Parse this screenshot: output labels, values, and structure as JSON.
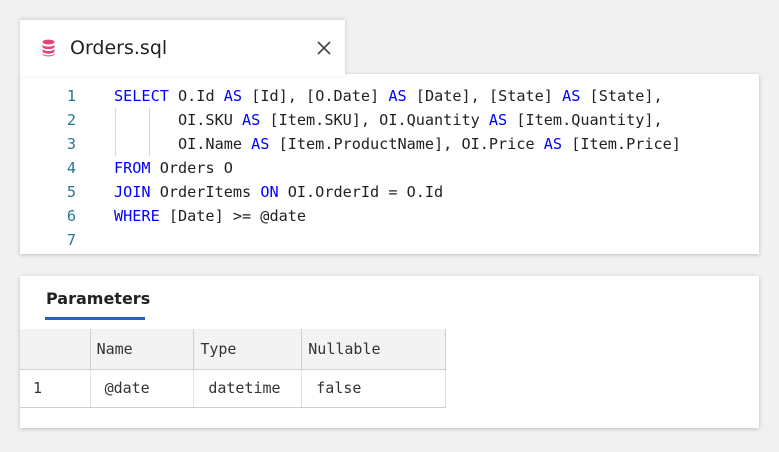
{
  "tab": {
    "title": "Orders.sql",
    "icon": "database-icon",
    "icon_color": "#e0457b",
    "close_icon": "close-icon"
  },
  "editor": {
    "keyword_color": "#0000ff",
    "line_number_color": "#237893",
    "lines": [
      {
        "num": "1",
        "tokens": [
          {
            "t": "SELECT",
            "kw": true
          },
          {
            "t": " O.Id ",
            "kw": false
          },
          {
            "t": "AS",
            "kw": true
          },
          {
            "t": " [Id], [O.Date] ",
            "kw": false
          },
          {
            "t": "AS",
            "kw": true
          },
          {
            "t": " [Date], [State] ",
            "kw": false
          },
          {
            "t": "AS",
            "kw": true
          },
          {
            "t": " [State],",
            "kw": false
          }
        ]
      },
      {
        "num": "2",
        "tokens": [
          {
            "t": "       OI.SKU ",
            "kw": false
          },
          {
            "t": "AS",
            "kw": true
          },
          {
            "t": " [Item.SKU], OI.Quantity ",
            "kw": false
          },
          {
            "t": "AS",
            "kw": true
          },
          {
            "t": " [Item.Quantity],",
            "kw": false
          }
        ]
      },
      {
        "num": "3",
        "tokens": [
          {
            "t": "       OI.Name ",
            "kw": false
          },
          {
            "t": "AS",
            "kw": true
          },
          {
            "t": " [Item.ProductName], OI.Price ",
            "kw": false
          },
          {
            "t": "AS",
            "kw": true
          },
          {
            "t": " [Item.Price]",
            "kw": false
          }
        ]
      },
      {
        "num": "4",
        "tokens": [
          {
            "t": "FROM",
            "kw": true
          },
          {
            "t": " Orders O",
            "kw": false
          }
        ]
      },
      {
        "num": "5",
        "tokens": [
          {
            "t": "JOIN",
            "kw": true
          },
          {
            "t": " OrderItems ",
            "kw": false
          },
          {
            "t": "ON",
            "kw": true
          },
          {
            "t": " OI.OrderId = O.Id",
            "kw": false
          }
        ]
      },
      {
        "num": "6",
        "tokens": [
          {
            "t": "WHERE",
            "kw": true
          },
          {
            "t": " [Date] >= @date",
            "kw": false
          }
        ]
      },
      {
        "num": "7",
        "tokens": []
      }
    ]
  },
  "parameters": {
    "title": "Parameters",
    "accent_color": "#2266b8",
    "columns": [
      "",
      "Name",
      "Type",
      "Nullable"
    ],
    "rows": [
      {
        "index": "1",
        "name": "@date",
        "type": "datetime",
        "nullable": "false"
      }
    ]
  }
}
